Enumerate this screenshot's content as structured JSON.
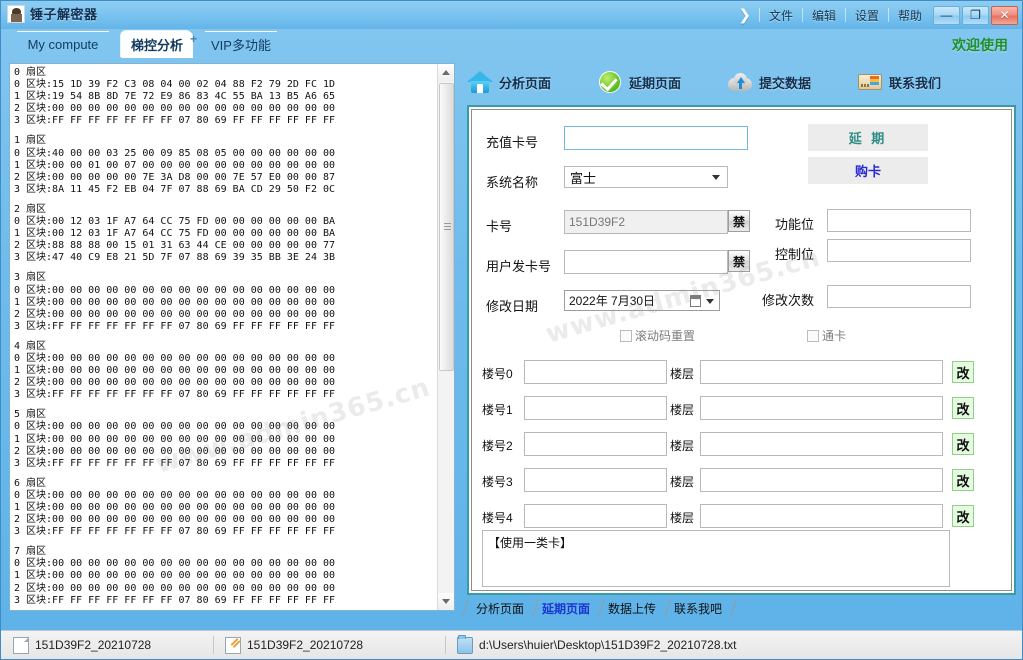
{
  "window": {
    "title": "锤子解密器",
    "icon": "app-hammer-icon",
    "menu": [
      "文件",
      "编辑",
      "设置",
      "帮助"
    ],
    "chevron": "❯",
    "controls": {
      "minimize": "—",
      "maximize": "❐",
      "close": "✕"
    }
  },
  "top_tabs": [
    {
      "label": "My compute",
      "active": false
    },
    {
      "label": "梯控分析",
      "active": true,
      "marker": "+"
    },
    {
      "label": "VIP多功能",
      "active": false
    }
  ],
  "welcome": "欢迎使用",
  "toolbar": [
    {
      "label": "分析页面",
      "icon": "home-icon"
    },
    {
      "label": "延期页面",
      "icon": "check-circle-icon"
    },
    {
      "label": "提交数据",
      "icon": "cloud-upload-icon"
    },
    {
      "label": "联系我们",
      "icon": "id-card-icon"
    }
  ],
  "hexdump": {
    "sector_label": "扇区",
    "block_label": "区块",
    "sectors": [
      {
        "index": "0",
        "blocks": [
          {
            "index": "0",
            "bytes": "15 1D 39 F2 C3 08 04 00 02 04 88 F2 79 2D FC 1D"
          },
          {
            "index": "1",
            "bytes": "19 54 8B 8D 7E 72 E9 86 83 4C 55 BA 13 B5 A6 65"
          },
          {
            "index": "2",
            "bytes": "00 00 00 00 00 00 00 00 00 00 00 00 00 00 00 00"
          },
          {
            "index": "3",
            "bytes": "FF FF FF FF FF FF FF 07 80 69 FF FF FF FF FF FF"
          }
        ]
      },
      {
        "index": "1",
        "blocks": [
          {
            "index": "0",
            "bytes": "40 00 00 03 25 00 09 85 08 05 00 00 00 00 00 00"
          },
          {
            "index": "1",
            "bytes": "00 00 01 00 07 00 00 00 00 00 00 00 00 00 00 00"
          },
          {
            "index": "2",
            "bytes": "00 00 00 00 00 7E 3A D8 00 00 7E 57 E0 00 00 87"
          },
          {
            "index": "3",
            "bytes": "8A 11 45 F2 EB 04 7F 07 88 69 BA CD 29 50 F2 0C"
          }
        ]
      },
      {
        "index": "2",
        "blocks": [
          {
            "index": "0",
            "bytes": "00 12 03 1F A7 64 CC 75 FD 00 00 00 00 00 00 BA"
          },
          {
            "index": "1",
            "bytes": "00 12 03 1F A7 64 CC 75 FD 00 00 00 00 00 00 BA"
          },
          {
            "index": "2",
            "bytes": "88 88 88 00 15 01 31 63 44 CE 00 00 00 00 00 77"
          },
          {
            "index": "3",
            "bytes": "47 40 C9 E8 21 5D 7F 07 88 69 39 35 BB 3E 24 3B"
          }
        ]
      },
      {
        "index": "3",
        "blocks": [
          {
            "index": "0",
            "bytes": "00 00 00 00 00 00 00 00 00 00 00 00 00 00 00 00"
          },
          {
            "index": "1",
            "bytes": "00 00 00 00 00 00 00 00 00 00 00 00 00 00 00 00"
          },
          {
            "index": "2",
            "bytes": "00 00 00 00 00 00 00 00 00 00 00 00 00 00 00 00"
          },
          {
            "index": "3",
            "bytes": "FF FF FF FF FF FF FF 07 80 69 FF FF FF FF FF FF"
          }
        ]
      },
      {
        "index": "4",
        "blocks": [
          {
            "index": "0",
            "bytes": "00 00 00 00 00 00 00 00 00 00 00 00 00 00 00 00"
          },
          {
            "index": "1",
            "bytes": "00 00 00 00 00 00 00 00 00 00 00 00 00 00 00 00"
          },
          {
            "index": "2",
            "bytes": "00 00 00 00 00 00 00 00 00 00 00 00 00 00 00 00"
          },
          {
            "index": "3",
            "bytes": "FF FF FF FF FF FF FF 07 80 69 FF FF FF FF FF FF"
          }
        ]
      },
      {
        "index": "5",
        "blocks": [
          {
            "index": "0",
            "bytes": "00 00 00 00 00 00 00 00 00 00 00 00 00 00 00 00"
          },
          {
            "index": "1",
            "bytes": "00 00 00 00 00 00 00 00 00 00 00 00 00 00 00 00"
          },
          {
            "index": "2",
            "bytes": "00 00 00 00 00 00 00 00 00 00 00 00 00 00 00 00"
          },
          {
            "index": "3",
            "bytes": "FF FF FF FF FF FF FF 07 80 69 FF FF FF FF FF FF"
          }
        ]
      },
      {
        "index": "6",
        "blocks": [
          {
            "index": "0",
            "bytes": "00 00 00 00 00 00 00 00 00 00 00 00 00 00 00 00"
          },
          {
            "index": "1",
            "bytes": "00 00 00 00 00 00 00 00 00 00 00 00 00 00 00 00"
          },
          {
            "index": "2",
            "bytes": "00 00 00 00 00 00 00 00 00 00 00 00 00 00 00 00"
          },
          {
            "index": "3",
            "bytes": "FF FF FF FF FF FF FF 07 80 69 FF FF FF FF FF FF"
          }
        ]
      },
      {
        "index": "7",
        "blocks": [
          {
            "index": "0",
            "bytes": "00 00 00 00 00 00 00 00 00 00 00 00 00 00 00 00"
          },
          {
            "index": "1",
            "bytes": "00 00 00 00 00 00 00 00 00 00 00 00 00 00 00 00"
          },
          {
            "index": "2",
            "bytes": "00 00 00 00 00 00 00 00 00 00 00 00 00 00 00 00"
          },
          {
            "index": "3",
            "bytes": "FF FF FF FF FF FF FF 07 80 69 FF FF FF FF FF FF"
          }
        ]
      }
    ]
  },
  "form": {
    "recharge_card_label": "充值卡号",
    "recharge_card_value": "",
    "system_name_label": "系统名称",
    "system_name_value": "富士",
    "card_no_label": "卡号",
    "card_no_value": "151D39F2",
    "user_card_no_label": "用户发卡号",
    "user_card_no_value": "",
    "modify_date_label": "修改日期",
    "modify_date_value": "2022年 7月30日",
    "ban_label": "禁",
    "extend_button": "延 期",
    "buy_button": "购卡",
    "function_bit_label": "功能位",
    "function_bit_value": "",
    "control_bit_label": "控制位",
    "control_bit_value": "",
    "modify_count_label": "修改次数",
    "modify_count_value": "",
    "rolling_reset_label": "滚动码重置",
    "universal_card_label": "通卡",
    "floor_label": "楼层",
    "edit_button": "改",
    "building_rows": [
      {
        "label": "楼号0",
        "building_value": "",
        "floor_value": ""
      },
      {
        "label": "楼号1",
        "building_value": "",
        "floor_value": ""
      },
      {
        "label": "楼号2",
        "building_value": "",
        "floor_value": ""
      },
      {
        "label": "楼号3",
        "building_value": "",
        "floor_value": ""
      },
      {
        "label": "楼号4",
        "building_value": "",
        "floor_value": ""
      }
    ],
    "memo_text": "【使用一类卡】"
  },
  "bottom_tabs": [
    {
      "label": "分析页面",
      "active": false
    },
    {
      "label": "延期页面",
      "active": true
    },
    {
      "label": "数据上传",
      "active": false
    },
    {
      "label": "联系我吧",
      "active": false
    }
  ],
  "statusbar": {
    "file_name": "151D39F2_20210728",
    "edit_name": "151D39F2_20210728",
    "path": "d:\\Users\\huier\\Desktop\\151D39F2_20210728.txt"
  },
  "watermark": "www.admin365.cn",
  "colors": {
    "window_blue": "#6fbcec",
    "panel_teal": "#3a9aa5",
    "accent_green": "#1e8f2a",
    "active_tab_blue": "#1b36d0"
  }
}
